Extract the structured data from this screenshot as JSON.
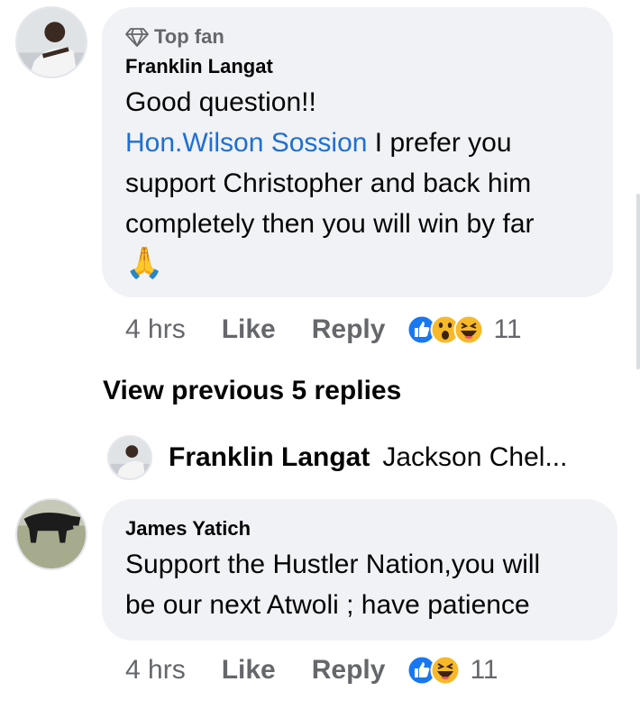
{
  "comments": [
    {
      "badge": "Top fan",
      "author": "Franklin Langat",
      "lines": [
        "Good question!!"
      ],
      "mention": "Hon.Wilson Sossion",
      "mention_rest": " I prefer you",
      "more_lines": [
        "support Christopher and back him",
        "completely then you will win by far"
      ],
      "emoji": "🙏",
      "time": "4 hrs",
      "like": "Like",
      "reply": "Reply",
      "reaction_count": "11",
      "reaction_icons": [
        "like-reaction",
        "wow-reaction",
        "haha-reaction"
      ]
    },
    {
      "author": "James Yatich",
      "lines": [
        "Support the Hustler Nation,you will",
        "be our next Atwoli ; have patience"
      ],
      "time": "4 hrs",
      "like": "Like",
      "reply": "Reply",
      "reaction_count": "11",
      "reaction_icons": [
        "like-reaction",
        "haha-reaction"
      ]
    }
  ],
  "view_previous": "View previous 5 replies",
  "reply_preview": {
    "author": "Franklin Langat",
    "text": "Jackson Chel..."
  },
  "colors": {
    "bubble": "#f0f2f5",
    "mention": "#1d6fd6",
    "meta": "#65676b",
    "like_blue": "#1877f2",
    "emoji_yellow": "#f7b928"
  }
}
